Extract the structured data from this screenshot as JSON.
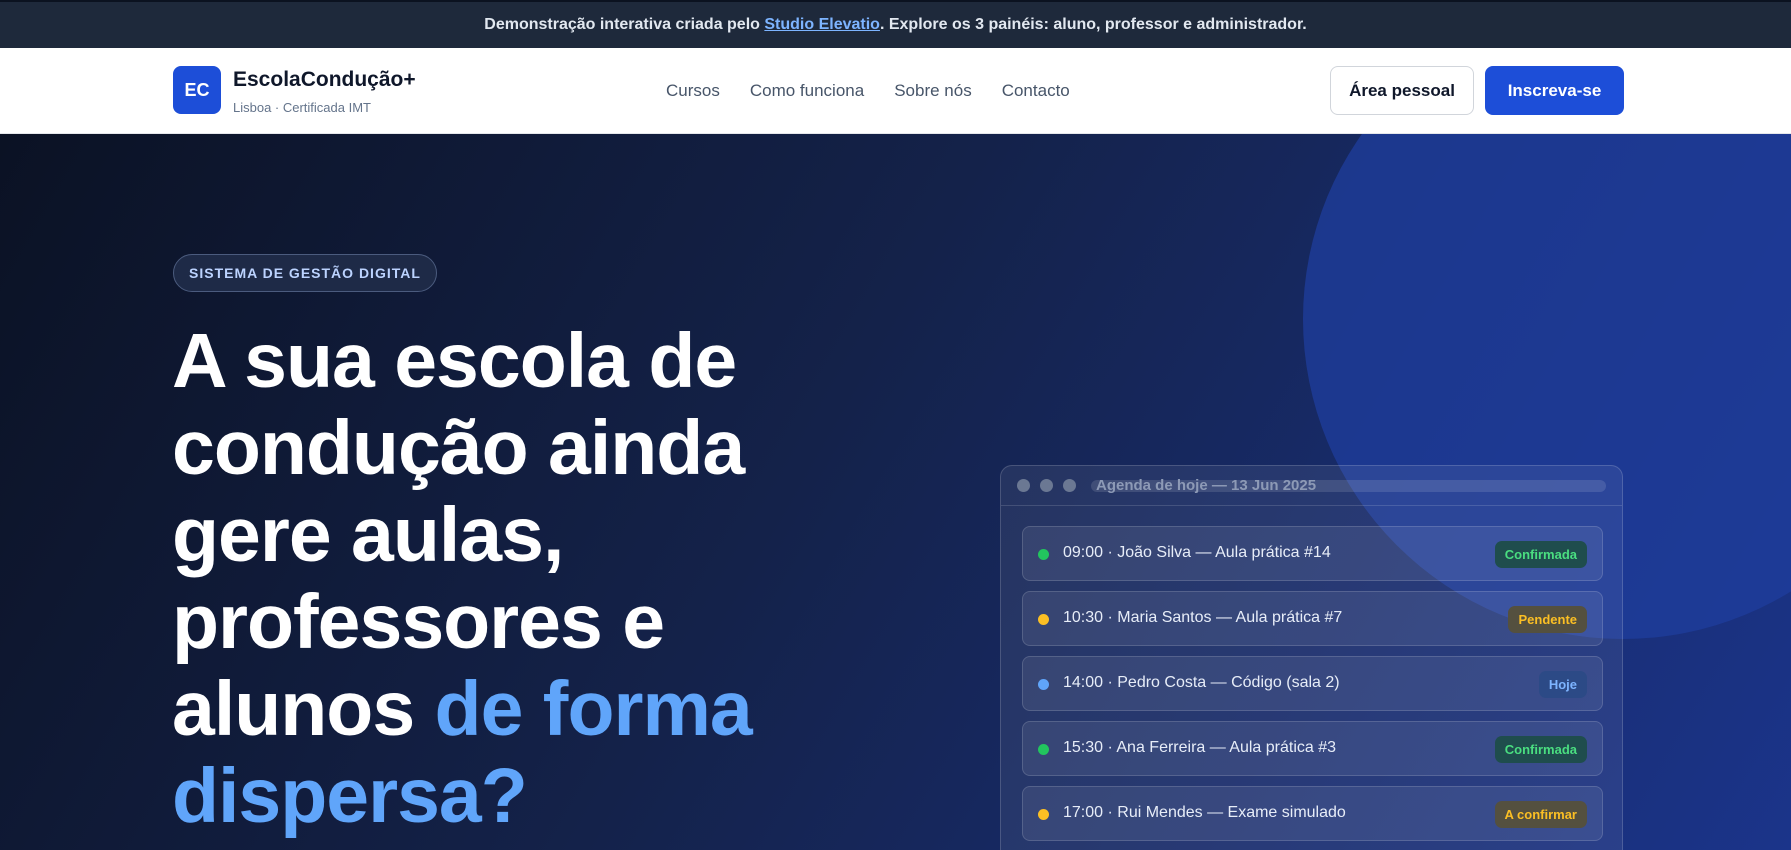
{
  "banner": {
    "prefix": "Demonstração interativa criada pelo",
    "link": "Studio Elevatio",
    "suffix": ". Explore os 3 painéis: aluno, professor e administrador."
  },
  "nav": {
    "logo_initials": "EC",
    "brand_name": "EscolaCondução+",
    "brand_sub": "Lisboa · Certificada IMT",
    "links": [
      "Cursos",
      "Como funciona",
      "Sobre nós",
      "Contacto"
    ],
    "personal_area": "Área pessoal",
    "signup": "Inscreva-se"
  },
  "hero": {
    "pill": "SISTEMA DE GESTÃO DIGITAL",
    "headline_main": "A sua escola de condução ainda gere aulas, professores e alunos ",
    "headline_accent": "de forma dispersa?"
  },
  "agenda": {
    "title": "Agenda de hoje — 13 Jun 2025",
    "items": [
      {
        "text": "09:00 · João Silva — Aula prática #14",
        "status": "Confirmada",
        "dot_color": "#22c55e",
        "badge_bg": "#1f4d4d",
        "badge_color": "#4ade80"
      },
      {
        "text": "10:30 · Maria Santos — Aula prática #7",
        "status": "Pendente",
        "dot_color": "#fbbf24",
        "badge_bg": "#54503f",
        "badge_color": "#fbbf24"
      },
      {
        "text": "14:00 · Pedro Costa — Código (sala 2)",
        "status": "Hoje",
        "dot_color": "#60a5fa",
        "badge_bg": "#2c4a86",
        "badge_color": "#7db4ff"
      },
      {
        "text": "15:30 · Ana Ferreira — Aula prática #3",
        "status": "Confirmada",
        "dot_color": "#22c55e",
        "badge_bg": "#1f4d4d",
        "badge_color": "#4ade80"
      },
      {
        "text": "17:00 · Rui Mendes — Exame simulado",
        "status": "A confirmar",
        "dot_color": "#fbbf24",
        "badge_bg": "#54503f",
        "badge_color": "#fbbf24"
      }
    ]
  }
}
